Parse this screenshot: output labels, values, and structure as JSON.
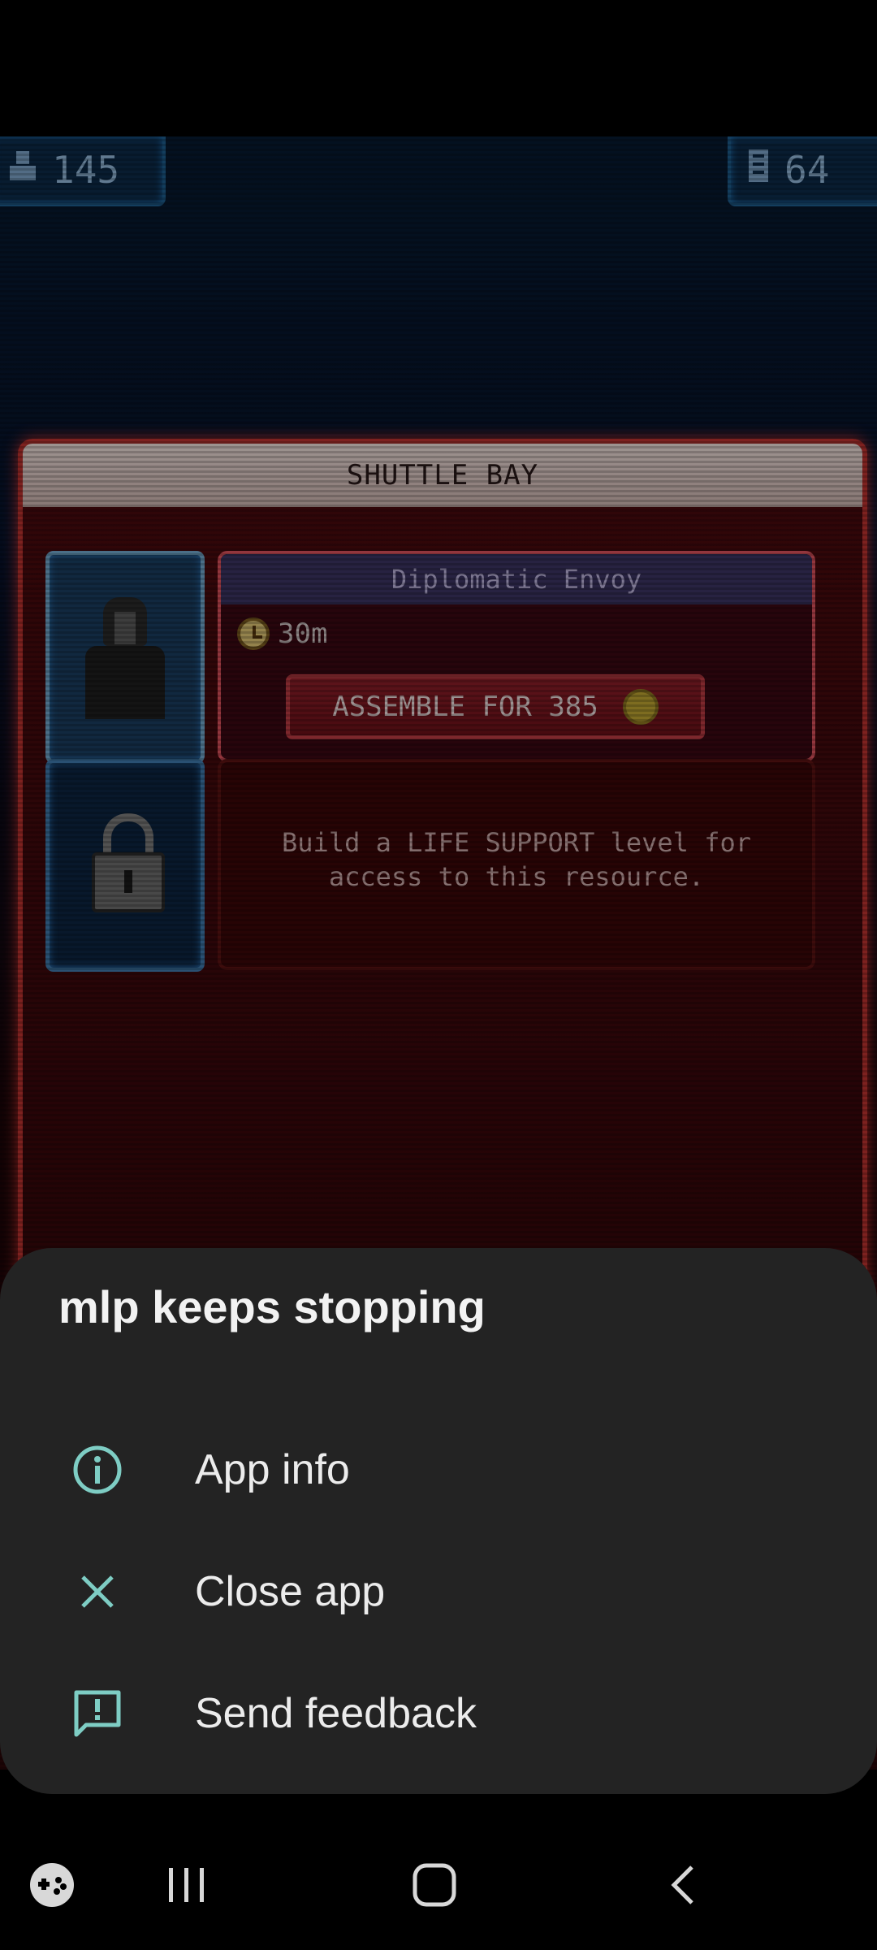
{
  "hud": {
    "crew_count": "145",
    "rooms_count": "64",
    "crew_icon": "person-icon",
    "rooms_icon": "building-icon"
  },
  "panel": {
    "title": "SHUTTLE BAY",
    "slot1": {
      "name": "Diplomatic Envoy",
      "timer": "30m",
      "button_label": "ASSEMBLE FOR 385"
    },
    "slot2": {
      "locked_line1": "Build a LIFE SUPPORT level for",
      "locked_line2": "access to this resource."
    }
  },
  "dialog": {
    "title": "mlp keeps stopping",
    "items": [
      {
        "label": "App info",
        "icon": "info-icon"
      },
      {
        "label": "Close app",
        "icon": "close-icon"
      },
      {
        "label": "Send feedback",
        "icon": "feedback-icon"
      }
    ],
    "accent_color": "#7ecdc4"
  },
  "navbar": {
    "icons": [
      "game-launcher-icon",
      "recents-icon",
      "home-icon",
      "back-icon"
    ]
  }
}
